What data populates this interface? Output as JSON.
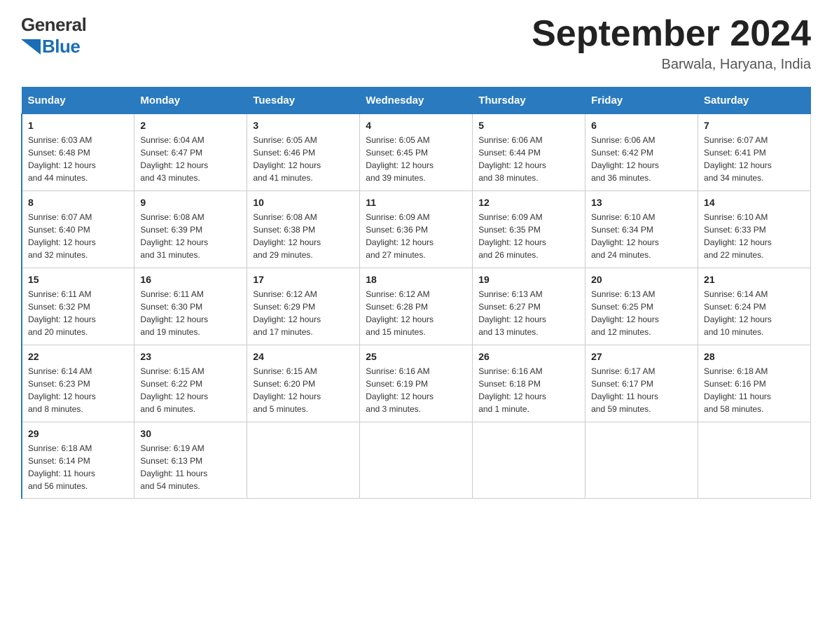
{
  "header": {
    "logo_general": "General",
    "logo_blue": "Blue",
    "month_year": "September 2024",
    "location": "Barwala, Haryana, India"
  },
  "days_of_week": [
    "Sunday",
    "Monday",
    "Tuesday",
    "Wednesday",
    "Thursday",
    "Friday",
    "Saturday"
  ],
  "weeks": [
    [
      {
        "day": "1",
        "sunrise": "6:03 AM",
        "sunset": "6:48 PM",
        "daylight": "12 hours and 44 minutes."
      },
      {
        "day": "2",
        "sunrise": "6:04 AM",
        "sunset": "6:47 PM",
        "daylight": "12 hours and 43 minutes."
      },
      {
        "day": "3",
        "sunrise": "6:05 AM",
        "sunset": "6:46 PM",
        "daylight": "12 hours and 41 minutes."
      },
      {
        "day": "4",
        "sunrise": "6:05 AM",
        "sunset": "6:45 PM",
        "daylight": "12 hours and 39 minutes."
      },
      {
        "day": "5",
        "sunrise": "6:06 AM",
        "sunset": "6:44 PM",
        "daylight": "12 hours and 38 minutes."
      },
      {
        "day": "6",
        "sunrise": "6:06 AM",
        "sunset": "6:42 PM",
        "daylight": "12 hours and 36 minutes."
      },
      {
        "day": "7",
        "sunrise": "6:07 AM",
        "sunset": "6:41 PM",
        "daylight": "12 hours and 34 minutes."
      }
    ],
    [
      {
        "day": "8",
        "sunrise": "6:07 AM",
        "sunset": "6:40 PM",
        "daylight": "12 hours and 32 minutes."
      },
      {
        "day": "9",
        "sunrise": "6:08 AM",
        "sunset": "6:39 PM",
        "daylight": "12 hours and 31 minutes."
      },
      {
        "day": "10",
        "sunrise": "6:08 AM",
        "sunset": "6:38 PM",
        "daylight": "12 hours and 29 minutes."
      },
      {
        "day": "11",
        "sunrise": "6:09 AM",
        "sunset": "6:36 PM",
        "daylight": "12 hours and 27 minutes."
      },
      {
        "day": "12",
        "sunrise": "6:09 AM",
        "sunset": "6:35 PM",
        "daylight": "12 hours and 26 minutes."
      },
      {
        "day": "13",
        "sunrise": "6:10 AM",
        "sunset": "6:34 PM",
        "daylight": "12 hours and 24 minutes."
      },
      {
        "day": "14",
        "sunrise": "6:10 AM",
        "sunset": "6:33 PM",
        "daylight": "12 hours and 22 minutes."
      }
    ],
    [
      {
        "day": "15",
        "sunrise": "6:11 AM",
        "sunset": "6:32 PM",
        "daylight": "12 hours and 20 minutes."
      },
      {
        "day": "16",
        "sunrise": "6:11 AM",
        "sunset": "6:30 PM",
        "daylight": "12 hours and 19 minutes."
      },
      {
        "day": "17",
        "sunrise": "6:12 AM",
        "sunset": "6:29 PM",
        "daylight": "12 hours and 17 minutes."
      },
      {
        "day": "18",
        "sunrise": "6:12 AM",
        "sunset": "6:28 PM",
        "daylight": "12 hours and 15 minutes."
      },
      {
        "day": "19",
        "sunrise": "6:13 AM",
        "sunset": "6:27 PM",
        "daylight": "12 hours and 13 minutes."
      },
      {
        "day": "20",
        "sunrise": "6:13 AM",
        "sunset": "6:25 PM",
        "daylight": "12 hours and 12 minutes."
      },
      {
        "day": "21",
        "sunrise": "6:14 AM",
        "sunset": "6:24 PM",
        "daylight": "12 hours and 10 minutes."
      }
    ],
    [
      {
        "day": "22",
        "sunrise": "6:14 AM",
        "sunset": "6:23 PM",
        "daylight": "12 hours and 8 minutes."
      },
      {
        "day": "23",
        "sunrise": "6:15 AM",
        "sunset": "6:22 PM",
        "daylight": "12 hours and 6 minutes."
      },
      {
        "day": "24",
        "sunrise": "6:15 AM",
        "sunset": "6:20 PM",
        "daylight": "12 hours and 5 minutes."
      },
      {
        "day": "25",
        "sunrise": "6:16 AM",
        "sunset": "6:19 PM",
        "daylight": "12 hours and 3 minutes."
      },
      {
        "day": "26",
        "sunrise": "6:16 AM",
        "sunset": "6:18 PM",
        "daylight": "12 hours and 1 minute."
      },
      {
        "day": "27",
        "sunrise": "6:17 AM",
        "sunset": "6:17 PM",
        "daylight": "11 hours and 59 minutes."
      },
      {
        "day": "28",
        "sunrise": "6:18 AM",
        "sunset": "6:16 PM",
        "daylight": "11 hours and 58 minutes."
      }
    ],
    [
      {
        "day": "29",
        "sunrise": "6:18 AM",
        "sunset": "6:14 PM",
        "daylight": "11 hours and 56 minutes."
      },
      {
        "day": "30",
        "sunrise": "6:19 AM",
        "sunset": "6:13 PM",
        "daylight": "11 hours and 54 minutes."
      },
      null,
      null,
      null,
      null,
      null
    ]
  ],
  "labels": {
    "sunrise_prefix": "Sunrise: ",
    "sunset_prefix": "Sunset: ",
    "daylight_prefix": "Daylight: "
  }
}
